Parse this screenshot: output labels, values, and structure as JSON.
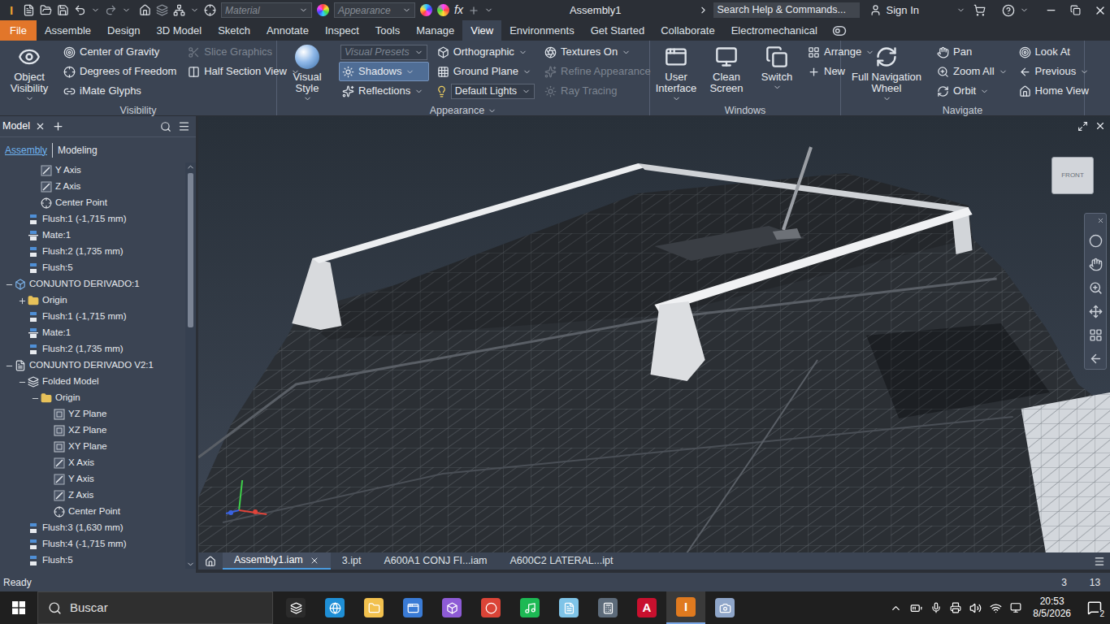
{
  "titlebar": {
    "logo": "I",
    "material": "Material",
    "appearance": "Appearance",
    "fx": "fx",
    "title": "Assembly1",
    "search": "Search Help & Commands...",
    "sign_in": "Sign In"
  },
  "ribbon_tabs": [
    {
      "label": "File",
      "kind": "file",
      "selected": false
    },
    {
      "label": "Assemble",
      "kind": "tab",
      "selected": false
    },
    {
      "label": "Design",
      "kind": "tab",
      "selected": false
    },
    {
      "label": "3D Model",
      "kind": "tab",
      "selected": false
    },
    {
      "label": "Sketch",
      "kind": "tab",
      "selected": false
    },
    {
      "label": "Annotate",
      "kind": "tab",
      "selected": false
    },
    {
      "label": "Inspect",
      "kind": "tab",
      "selected": false
    },
    {
      "label": "Tools",
      "kind": "tab",
      "selected": false
    },
    {
      "label": "Manage",
      "kind": "tab",
      "selected": false
    },
    {
      "label": "View",
      "kind": "tab",
      "selected": true
    },
    {
      "label": "Environments",
      "kind": "tab",
      "selected": false
    },
    {
      "label": "Get Started",
      "kind": "tab",
      "selected": false
    },
    {
      "label": "Collaborate",
      "kind": "tab",
      "selected": false
    },
    {
      "label": "Electromechanical",
      "kind": "tab",
      "selected": false
    }
  ],
  "ribbon": {
    "visibility": {
      "label": "Visibility",
      "label_dropdown": false,
      "big": [
        {
          "label": "Object Visibility",
          "dropdown": true
        }
      ],
      "columns": [
        [
          {
            "label": "Center of Gravity",
            "kind": "button",
            "disabled": false,
            "selected": false,
            "dropdown": false
          },
          {
            "label": "Degrees of Freedom",
            "kind": "button",
            "disabled": false,
            "selected": false,
            "dropdown": false
          },
          {
            "label": "iMate Glyphs",
            "kind": "button",
            "disabled": false,
            "selected": false,
            "dropdown": false
          }
        ],
        [
          {
            "label": "Slice Graphics",
            "kind": "button",
            "disabled": true,
            "selected": false,
            "dropdown": false
          },
          {
            "label": "Half Section View",
            "kind": "button",
            "disabled": false,
            "selected": false,
            "dropdown": true
          }
        ]
      ]
    },
    "appearance": {
      "label": "Appearance",
      "label_dropdown": true,
      "big": [
        {
          "label": "Visual Style",
          "dropdown": true
        }
      ],
      "columns": [
        [
          {
            "label": "Visual Presets",
            "kind": "field",
            "disabled": true,
            "selected": false,
            "dropdown": true
          },
          {
            "label": "Shadows",
            "kind": "button",
            "disabled": false,
            "selected": true,
            "dropdown": true
          },
          {
            "label": "Reflections",
            "kind": "button",
            "disabled": false,
            "selected": false,
            "dropdown": true
          }
        ],
        [
          {
            "label": "Orthographic",
            "kind": "button",
            "disabled": false,
            "selected": false,
            "dropdown": true
          },
          {
            "label": "Ground Plane",
            "kind": "button",
            "disabled": false,
            "selected": false,
            "dropdown": true
          },
          {
            "label": "Default Lights",
            "kind": "field",
            "disabled": false,
            "selected": false,
            "dropdown": true
          }
        ],
        [
          {
            "label": "Textures On",
            "kind": "button",
            "disabled": false,
            "selected": false,
            "dropdown": true
          },
          {
            "label": "Refine Appearance",
            "kind": "button",
            "disabled": true,
            "selected": false,
            "dropdown": false
          },
          {
            "label": "Ray Tracing",
            "kind": "button",
            "disabled": true,
            "selected": false,
            "dropdown": false
          }
        ]
      ]
    },
    "windows": {
      "label": "Windows",
      "label_dropdown": false,
      "big": [
        {
          "label": "User Interface",
          "dropdown": true
        },
        {
          "label": "Clean Screen",
          "dropdown": false
        },
        {
          "label": "Switch",
          "dropdown": true
        }
      ],
      "columns": [
        [
          {
            "label": "Arrange",
            "kind": "button",
            "disabled": false,
            "selected": false,
            "dropdown": true
          },
          {
            "label": "New",
            "kind": "button",
            "disabled": false,
            "selected": false,
            "dropdown": false
          }
        ]
      ]
    },
    "navigate": {
      "label": "Navigate",
      "label_dropdown": false,
      "big": [
        {
          "label": "Full Navigation Wheel",
          "dropdown": true
        }
      ],
      "columns": [
        [
          {
            "label": "Pan",
            "kind": "button",
            "disabled": false,
            "selected": false,
            "dropdown": false
          },
          {
            "label": "Zoom All",
            "kind": "button",
            "disabled": false,
            "selected": false,
            "dropdown": true
          },
          {
            "label": "Orbit",
            "kind": "button",
            "disabled": false,
            "selected": false,
            "dropdown": true
          }
        ],
        [
          {
            "label": "Look At",
            "kind": "button",
            "disabled": false,
            "selected": false,
            "dropdown": false
          },
          {
            "label": "Previous",
            "kind": "button",
            "disabled": false,
            "selected": false,
            "dropdown": true
          },
          {
            "label": "Home View",
            "kind": "button",
            "disabled": false,
            "selected": false,
            "dropdown": false
          }
        ]
      ]
    }
  },
  "browser": {
    "tabs": [
      {
        "label": "Model",
        "selected": true
      }
    ],
    "modes": [
      {
        "label": "Assembly",
        "selected": true
      },
      {
        "label": "Modeling",
        "selected": false
      }
    ],
    "scrollbar": {
      "level": 0.4
    },
    "nodes": [
      {
        "label": "Y Axis",
        "depth": 2,
        "kind": "axis"
      },
      {
        "label": "Z Axis",
        "depth": 2,
        "kind": "axis"
      },
      {
        "label": "Center Point",
        "depth": 2,
        "kind": "point"
      },
      {
        "label": "Flush:1 (-1,715 mm)",
        "depth": 1,
        "kind": "flush"
      },
      {
        "label": "Mate:1",
        "depth": 1,
        "kind": "mate"
      },
      {
        "label": "Flush:2 (1,735 mm)",
        "depth": 1,
        "kind": "flush"
      },
      {
        "label": "Flush:5",
        "depth": 1,
        "kind": "flush"
      },
      {
        "label": "CONJUNTO DERIVADO:1",
        "depth": 0,
        "kind": "assembly",
        "expanded": true
      },
      {
        "label": "Origin",
        "depth": 1,
        "kind": "folder",
        "expanded": false
      },
      {
        "label": "Flush:1 (-1,715 mm)",
        "depth": 1,
        "kind": "flush"
      },
      {
        "label": "Mate:1",
        "depth": 1,
        "kind": "mate"
      },
      {
        "label": "Flush:2 (1,735 mm)",
        "depth": 1,
        "kind": "flush"
      },
      {
        "label": "CONJUNTO DERIVADO V2:1",
        "depth": 0,
        "kind": "part",
        "expanded": true
      },
      {
        "label": "Folded Model",
        "depth": 1,
        "kind": "folded",
        "expanded": true
      },
      {
        "label": "Origin",
        "depth": 2,
        "kind": "folder",
        "expanded": true
      },
      {
        "label": "YZ Plane",
        "depth": 3,
        "kind": "plane"
      },
      {
        "label": "XZ Plane",
        "depth": 3,
        "kind": "plane"
      },
      {
        "label": "XY Plane",
        "depth": 3,
        "kind": "plane"
      },
      {
        "label": "X Axis",
        "depth": 3,
        "kind": "axis"
      },
      {
        "label": "Y Axis",
        "depth": 3,
        "kind": "axis"
      },
      {
        "label": "Z Axis",
        "depth": 3,
        "kind": "axis"
      },
      {
        "label": "Center Point",
        "depth": 3,
        "kind": "point"
      },
      {
        "label": "Flush:3 (1,630 mm)",
        "depth": 1,
        "kind": "flush"
      },
      {
        "label": "Flush:4 (-1,715 mm)",
        "depth": 1,
        "kind": "flush"
      },
      {
        "label": "Flush:5",
        "depth": 1,
        "kind": "flush"
      }
    ]
  },
  "viewcube": {
    "face": "FRONT"
  },
  "document_tabs": [
    {
      "label": "Assembly1.iam",
      "selected": true,
      "closable": true
    },
    {
      "label": "3.ipt",
      "selected": false,
      "closable": false
    },
    {
      "label": "A600A1 CONJ FI...iam",
      "selected": false,
      "closable": false
    },
    {
      "label": "A600C2 LATERAL...ipt",
      "selected": false,
      "closable": false
    }
  ],
  "status_bar": {
    "text": "Ready",
    "counts": [
      "3",
      "13"
    ]
  },
  "taskbar": {
    "search": "Buscar",
    "time": "20:53",
    "date": "8/5/2026",
    "notifications": "2",
    "apps": [
      {
        "color": "#2b2b2b",
        "active": false
      },
      {
        "color": "#1f8fd6",
        "active": false
      },
      {
        "color": "#f2c14e",
        "active": false
      },
      {
        "color": "#3a7bd5",
        "active": false
      },
      {
        "color": "#8e5bd6",
        "active": false
      },
      {
        "color": "#db4437",
        "active": false
      },
      {
        "color": "#1db954",
        "active": false
      },
      {
        "color": "#7fc4e8",
        "active": false
      },
      {
        "color": "#5d6b7a",
        "active": false
      },
      {
        "color": "#c8102e",
        "active": false,
        "glyph": "A"
      },
      {
        "color": "#e07a1f",
        "active": true,
        "glyph": "I"
      },
      {
        "color": "#8fa6c9",
        "active": false
      }
    ]
  }
}
